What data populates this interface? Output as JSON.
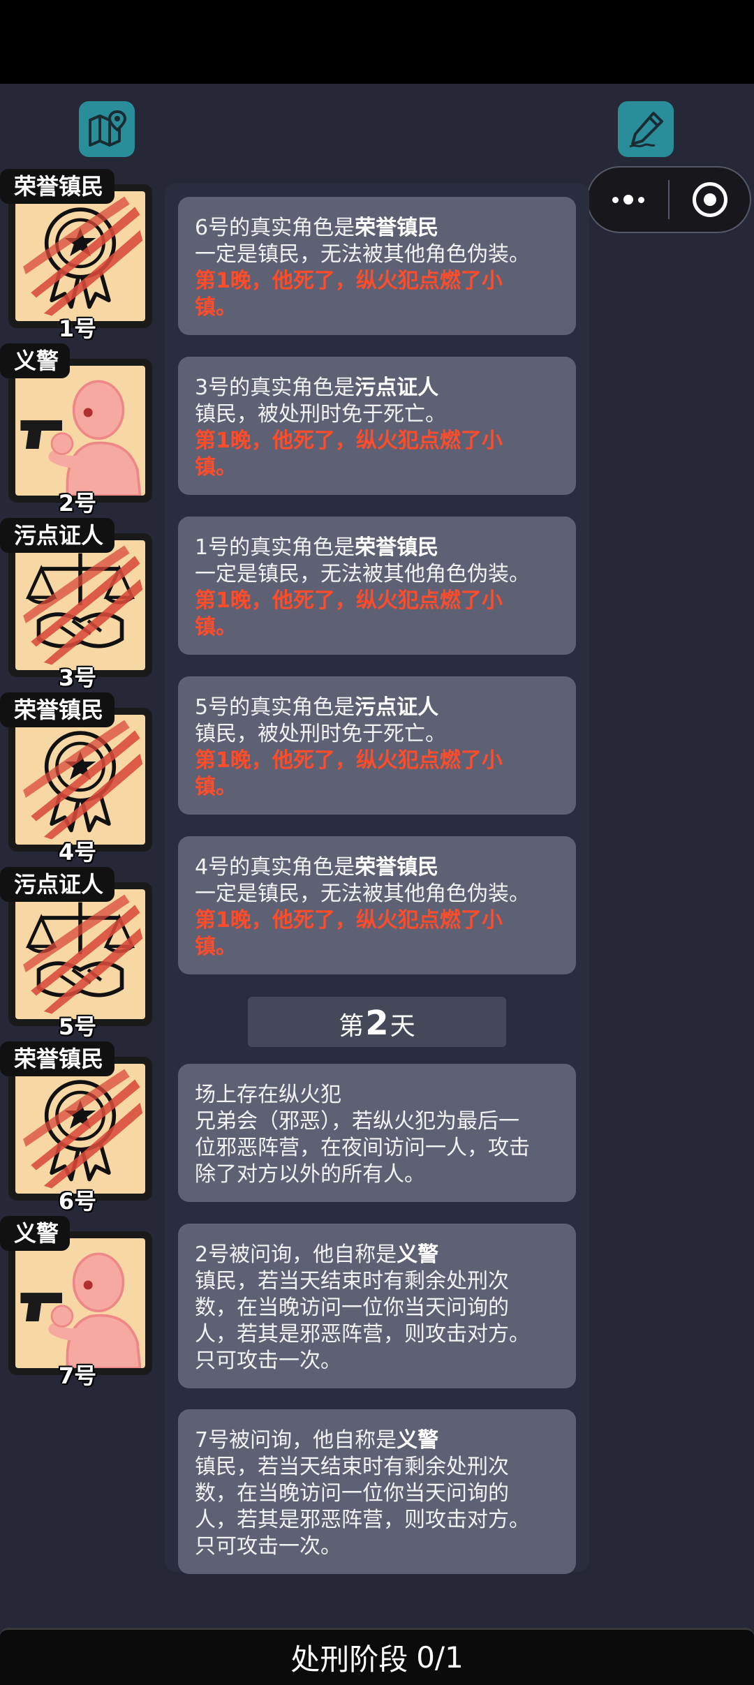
{
  "toolbar": {
    "map_icon": "map-pin-icon",
    "edit_icon": "pencil-icon"
  },
  "capsule": {
    "more_icon": "more-dots-icon",
    "close_icon": "target-circle-icon"
  },
  "players": [
    {
      "role": "荣誉镇民",
      "number": "1号",
      "art": "medal",
      "dead": true
    },
    {
      "role": "义警",
      "number": "2号",
      "art": "gunman",
      "dead": false
    },
    {
      "role": "污点证人",
      "number": "3号",
      "art": "scales",
      "dead": true
    },
    {
      "role": "荣誉镇民",
      "number": "4号",
      "art": "medal",
      "dead": true
    },
    {
      "role": "污点证人",
      "number": "5号",
      "art": "scales",
      "dead": true
    },
    {
      "role": "荣誉镇民",
      "number": "6号",
      "art": "medal",
      "dead": true
    },
    {
      "role": "义警",
      "number": "7号",
      "art": "gunman",
      "dead": false
    }
  ],
  "log": {
    "night_messages": [
      {
        "prefix": "6号的真实角色是",
        "role": "荣誉镇民",
        "desc": "一定是镇民，无法被其他角色伪装。",
        "death_1": "第1晚，他死了，纵火犯点燃了小",
        "death_2": "镇。"
      },
      {
        "prefix": "3号的真实角色是",
        "role": "污点证人",
        "desc": "镇民，被处刑时免于死亡。",
        "death_1": "第1晚，他死了，纵火犯点燃了小",
        "death_2": "镇。"
      },
      {
        "prefix": "1号的真实角色是",
        "role": "荣誉镇民",
        "desc": "一定是镇民，无法被其他角色伪装。",
        "death_1": "第1晚，他死了，纵火犯点燃了小",
        "death_2": "镇。"
      },
      {
        "prefix": "5号的真实角色是",
        "role": "污点证人",
        "desc": "镇民，被处刑时免于死亡。",
        "death_1": "第1晚，他死了，纵火犯点燃了小",
        "death_2": "镇。"
      },
      {
        "prefix": "4号的真实角色是",
        "role": "荣誉镇民",
        "desc": "一定是镇民，无法被其他角色伪装。",
        "death_1": "第1晚，他死了，纵火犯点燃了小",
        "death_2": "镇。"
      }
    ],
    "day": {
      "prefix": "第",
      "number": "2",
      "suffix": "天"
    },
    "arsonist": {
      "lines": [
        "场上存在纵火犯",
        "兄弟会（邪恶），若纵火犯为最后一",
        "位邪恶阵营，在夜间访问一人，攻击",
        "除了对方以外的所有人。"
      ]
    },
    "interrogations": [
      {
        "prefix": "2号被问询，他自称是",
        "role": "义警",
        "lines": [
          "镇民，若当天结束时有剩余处刑次",
          "数，在当晚访问一位你当天问询的",
          "人，若其是邪恶阵营，则攻击对方。",
          "只可攻击一次。"
        ]
      },
      {
        "prefix": "7号被问询，他自称是",
        "role": "义警",
        "lines": [
          "镇民，若当天结束时有剩余处刑次",
          "数，在当晚访问一位你当天问询的",
          "人，若其是邪恶阵营，则攻击对方。",
          "只可攻击一次。"
        ]
      }
    ]
  },
  "phase": {
    "label": "处刑阶段",
    "count": "0/1"
  },
  "colors": {
    "accent_teal": "#2a8d9a",
    "death_red": "#ff4c2a",
    "card_bg": "#f7d8a4"
  }
}
